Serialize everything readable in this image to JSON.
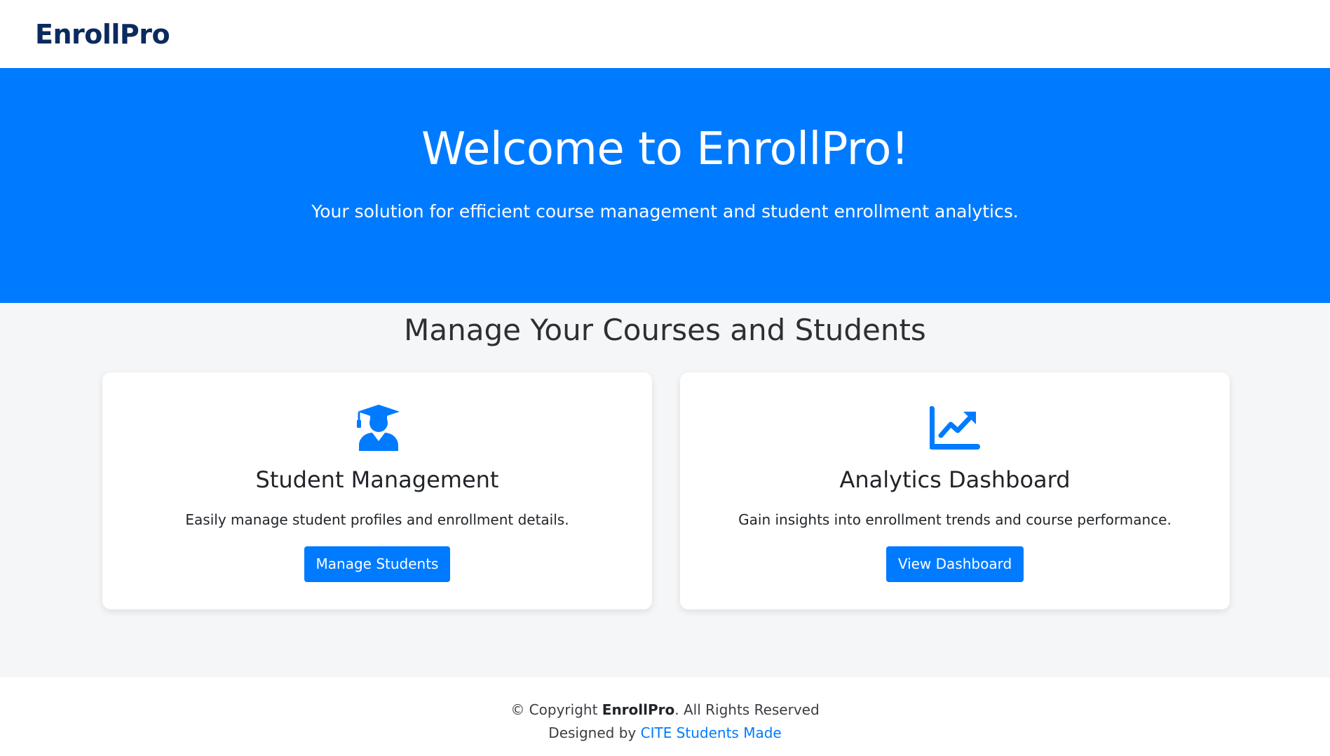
{
  "header": {
    "brand": "EnrollPro"
  },
  "hero": {
    "title": "Welcome to EnrollPro!",
    "subtitle": "Your solution for efficient course management and student enrollment analytics."
  },
  "features": {
    "section_title": "Manage Your Courses and Students",
    "cards": [
      {
        "icon": "graduate-icon",
        "title": "Student Management",
        "description": "Easily manage student profiles and enrollment details.",
        "button_label": "Manage Students"
      },
      {
        "icon": "chart-line-icon",
        "title": "Analytics Dashboard",
        "description": "Gain insights into enrollment trends and course performance.",
        "button_label": "View Dashboard"
      }
    ]
  },
  "footer": {
    "copyright_prefix": "© Copyright ",
    "brand": "EnrollPro",
    "copyright_suffix": ". All Rights Reserved",
    "designed_by_prefix": "Designed by ",
    "designed_by_link": "CITE Students Made"
  },
  "colors": {
    "primary": "#007bff",
    "brand_text": "#0b2a5e",
    "page_background": "#f5f6f8"
  }
}
